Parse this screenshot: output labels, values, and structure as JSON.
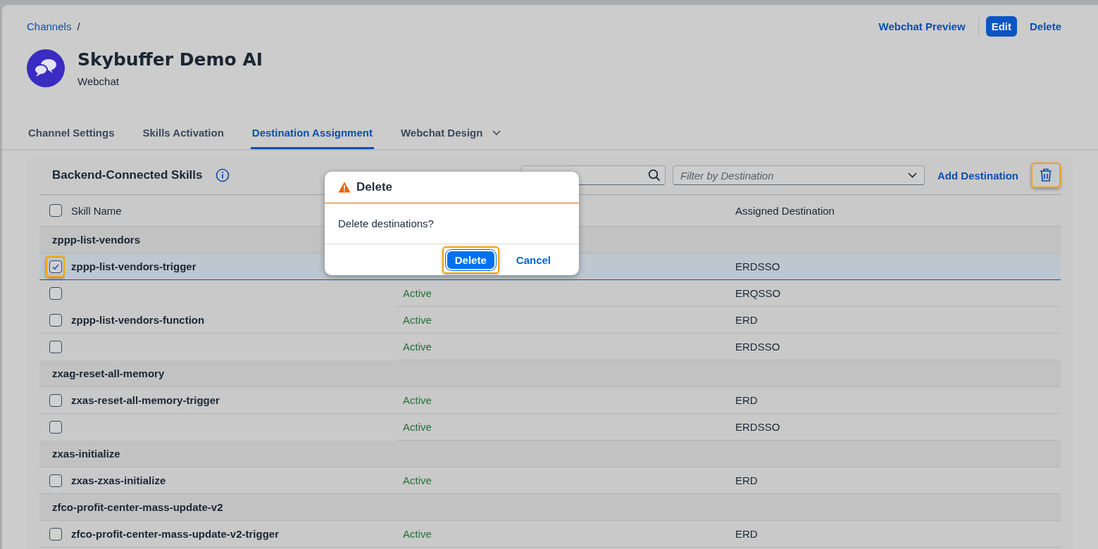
{
  "breadcrumb": {
    "link": "Channels",
    "separator": "/"
  },
  "header": {
    "title": "Skybuffer Demo AI",
    "subtitle": "Webchat"
  },
  "actions": [
    {
      "label": "Webchat Preview",
      "kind": "link"
    },
    {
      "label": "Edit",
      "kind": "primary"
    },
    {
      "label": "Delete",
      "kind": "link"
    }
  ],
  "tabs": [
    {
      "label": "Channel Settings",
      "selected": false,
      "has_menu": false
    },
    {
      "label": "Skills Activation",
      "selected": false,
      "has_menu": false
    },
    {
      "label": "Destination Assignment",
      "selected": true,
      "has_menu": false
    },
    {
      "label": "Webchat Design",
      "selected": false,
      "has_menu": true
    }
  ],
  "panel": {
    "title": "Backend-Connected Skills",
    "filter": {
      "placeholder": "Filter by Destination"
    },
    "add_button": "Add Destination",
    "delete_highlighted": true
  },
  "table": {
    "columns": [
      "Skill Name",
      "Assigned Destination"
    ],
    "select_all_checked": false,
    "rows": [
      {
        "kind": "group",
        "label": "zppp-list-vendors"
      },
      {
        "kind": "item",
        "skill": "zppp-list-vendors-trigger",
        "destination": "ERDSSO",
        "checked": true,
        "selected": true,
        "highlighted": true
      },
      {
        "kind": "item",
        "status": "Active",
        "destination": "ERQSSO",
        "checked": false,
        "selected": false,
        "highlighted": false
      },
      {
        "kind": "item",
        "skill": "zppp-list-vendors-function",
        "status": "Active",
        "destination": "ERD",
        "checked": false,
        "selected": false,
        "highlighted": false
      },
      {
        "kind": "item",
        "status": "Active",
        "destination": "ERDSSO",
        "checked": false,
        "selected": false,
        "highlighted": false
      },
      {
        "kind": "group",
        "label": "zxag-reset-all-memory"
      },
      {
        "kind": "item",
        "skill": "zxas-reset-all-memory-trigger",
        "status": "Active",
        "destination": "ERD",
        "checked": false,
        "selected": false,
        "highlighted": false
      },
      {
        "kind": "item",
        "status": "Active",
        "destination": "ERDSSO",
        "checked": false,
        "selected": false,
        "highlighted": false
      },
      {
        "kind": "group",
        "label": "zxas-initialize"
      },
      {
        "kind": "item",
        "skill": "zxas-zxas-initialize",
        "status": "Active",
        "destination": "ERD",
        "checked": false,
        "selected": false,
        "highlighted": false
      },
      {
        "kind": "group",
        "label": "zfco-profit-center-mass-update-v2"
      },
      {
        "kind": "item",
        "skill": "zfco-profit-center-mass-update-v2-trigger",
        "status": "Active",
        "destination": "ERD",
        "checked": false,
        "selected": false,
        "highlighted": false
      }
    ]
  },
  "dialog": {
    "title": "Delete",
    "message": "Delete destinations?",
    "buttons": [
      {
        "label": "Delete",
        "kind": "primary",
        "highlighted": true
      },
      {
        "label": "Cancel",
        "kind": "secondary",
        "highlighted": false
      }
    ]
  }
}
